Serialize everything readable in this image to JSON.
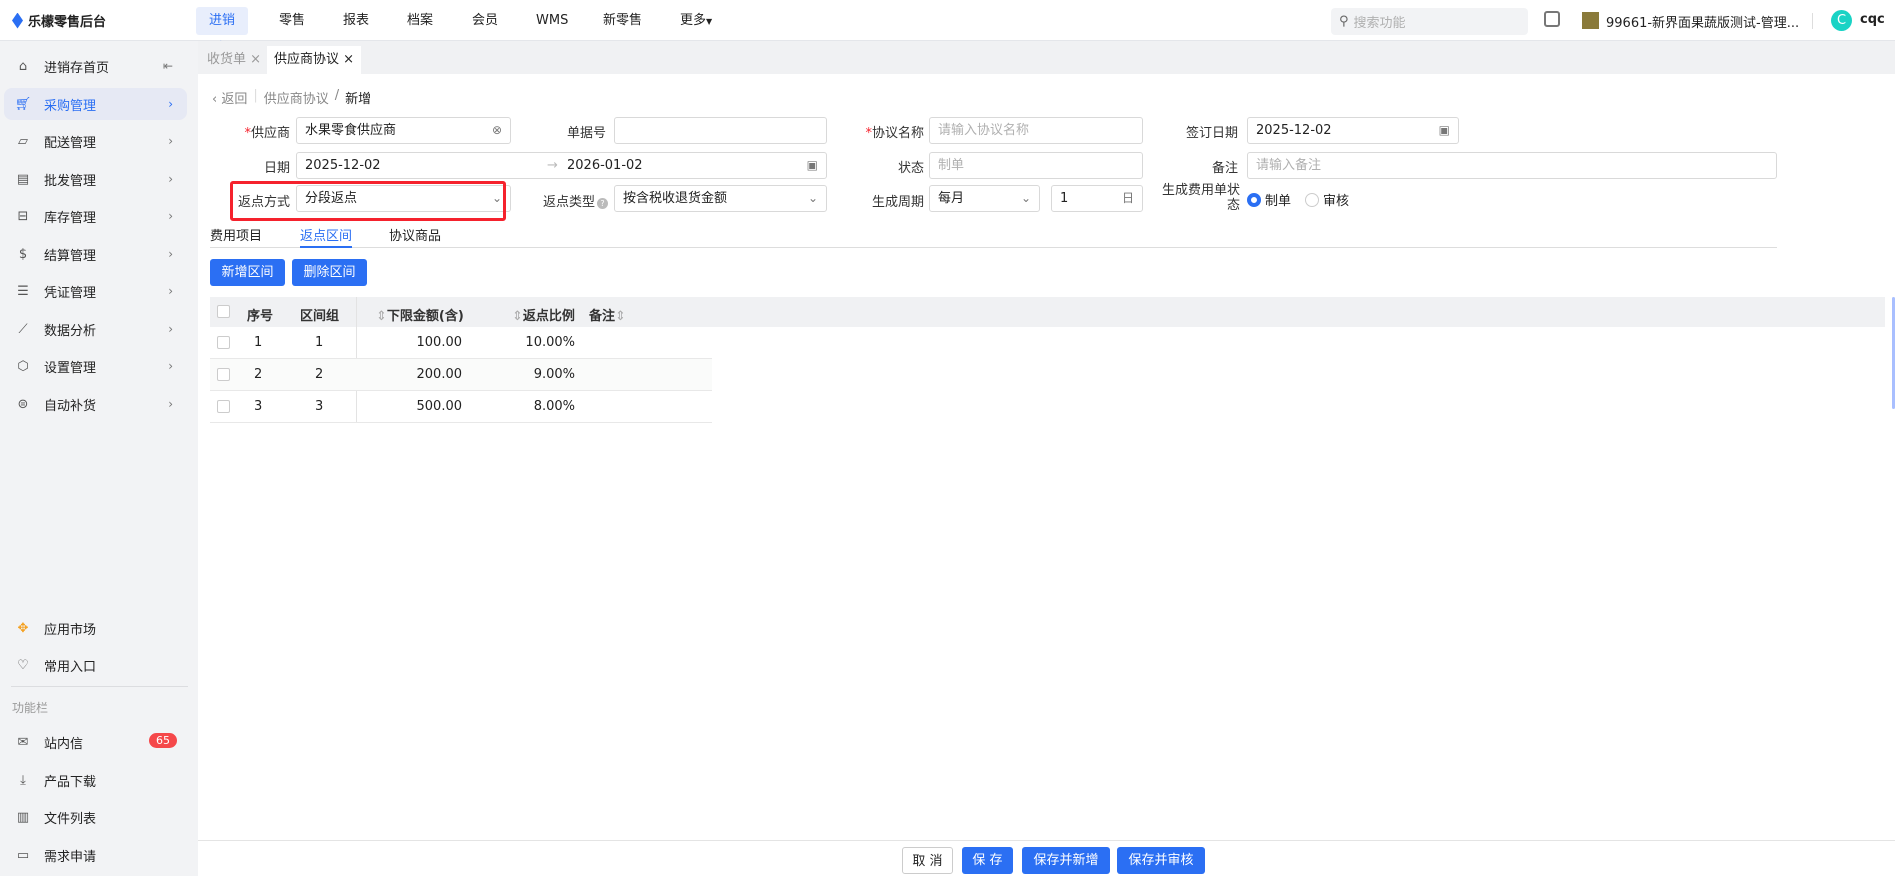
{
  "brand": {
    "name": "乐檬零售后台"
  },
  "topnav": {
    "items": [
      "进销存",
      "零售",
      "报表",
      "档案",
      "会员",
      "WMS",
      "新零售",
      "更多"
    ],
    "active": 0
  },
  "search": {
    "placeholder": "搜索功能"
  },
  "store": {
    "name": "99661-新界面果蔬版测试-管理..."
  },
  "user": {
    "initial": "C",
    "name": "cqc"
  },
  "sidebar": {
    "home": "进销存首页",
    "items": [
      "采购管理",
      "配送管理",
      "批发管理",
      "库存管理",
      "结算管理",
      "凭证管理",
      "数据分析",
      "设置管理",
      "自动补货"
    ],
    "bottom": [
      "应用市场",
      "常用入口"
    ],
    "section": "功能栏",
    "tools": [
      "站内信",
      "产品下载",
      "文件列表",
      "需求申请"
    ],
    "badge": "65"
  },
  "page_tabs": [
    {
      "label": "收货单",
      "close": "×"
    },
    {
      "label": "供应商协议",
      "close": "×"
    }
  ],
  "breadcrumb": {
    "back": "返回",
    "parent": "供应商协议",
    "sep": "/",
    "current": "新增"
  },
  "form": {
    "supplier": {
      "label": "供应商",
      "value": "水果零食供应商"
    },
    "doc_no": {
      "label": "单据号",
      "value": ""
    },
    "agreement_name": {
      "label": "协议名称",
      "placeholder": "请输入协议名称"
    },
    "sign_date": {
      "label": "签订日期",
      "value": "2025-12-02"
    },
    "date": {
      "label": "日期",
      "start": "2025-12-02",
      "end": "2026-01-02"
    },
    "status": {
      "label": "状态",
      "value": "制单"
    },
    "remark": {
      "label": "备注",
      "placeholder": "请输入备注"
    },
    "rebate_method": {
      "label": "返点方式",
      "value": "分段返点"
    },
    "rebate_type": {
      "label": "返点类型",
      "value": "按含税收退货金额"
    },
    "cycle": {
      "label": "生成周期",
      "value": "每月",
      "day": "1",
      "day_unit": "日"
    },
    "fee_status": {
      "label": "生成费用单状态",
      "options": [
        "制单",
        "审核"
      ],
      "selected": 0
    }
  },
  "sub_tabs": [
    "费用项目",
    "返点区间",
    "协议商品"
  ],
  "sub_tab_active": 1,
  "actions": {
    "add": "新增区间",
    "delete": "删除区间"
  },
  "table": {
    "headers": [
      "序号",
      "区间组",
      "下限金额(含)",
      "返点比例",
      "备注"
    ],
    "rows": [
      [
        "1",
        "1",
        "100.00",
        "10.00%",
        ""
      ],
      [
        "2",
        "2",
        "200.00",
        "9.00%",
        ""
      ],
      [
        "3",
        "3",
        "500.00",
        "8.00%",
        ""
      ]
    ]
  },
  "footer": {
    "cancel": "取 消",
    "save": "保 存",
    "save_new": "保存并新增",
    "save_audit": "保存并审核"
  },
  "colors": {
    "primary": "#2b6ff3",
    "highlight_box": "#f5222d",
    "badge": "#f5484a"
  }
}
